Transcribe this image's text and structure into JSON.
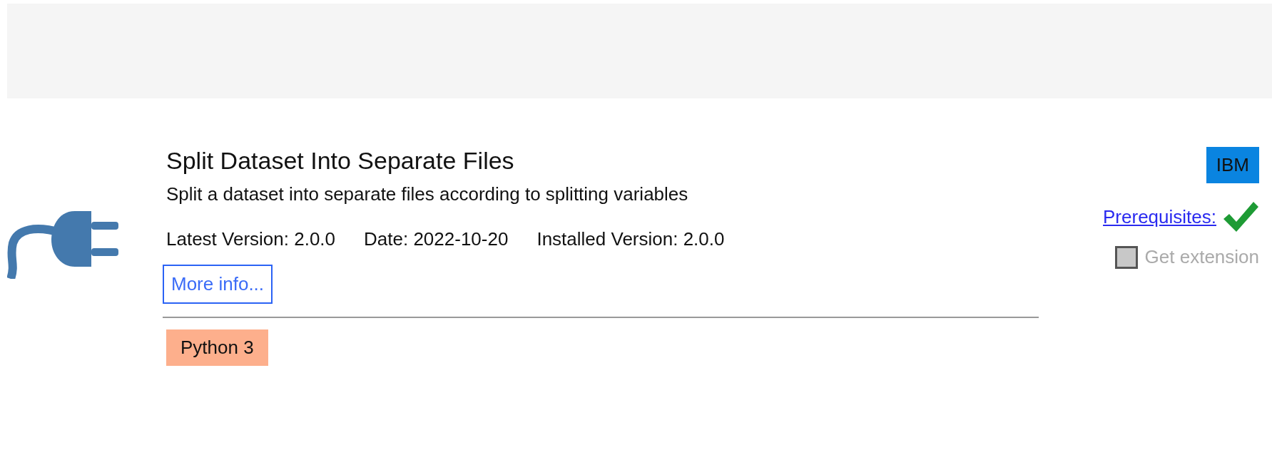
{
  "extension": {
    "title": "Split Dataset Into Separate Files",
    "description": "Split a dataset into separate files according to splitting variables",
    "meta": [
      {
        "text": "Latest Version: 2.0.0"
      },
      {
        "text": "Date: 2022-10-20"
      },
      {
        "text": "Installed Version: 2.0.0"
      }
    ],
    "more_info": "More info...",
    "tags": [
      {
        "label": "Python 3",
        "color": "#fdaf8c"
      }
    ],
    "provider": {
      "label": "IBM",
      "color": "#0a84e0"
    },
    "prerequisites": {
      "label": "Prerequisites:",
      "met": true
    },
    "get_extension": {
      "label": "Get extension",
      "checked": false,
      "disabled": true
    }
  }
}
